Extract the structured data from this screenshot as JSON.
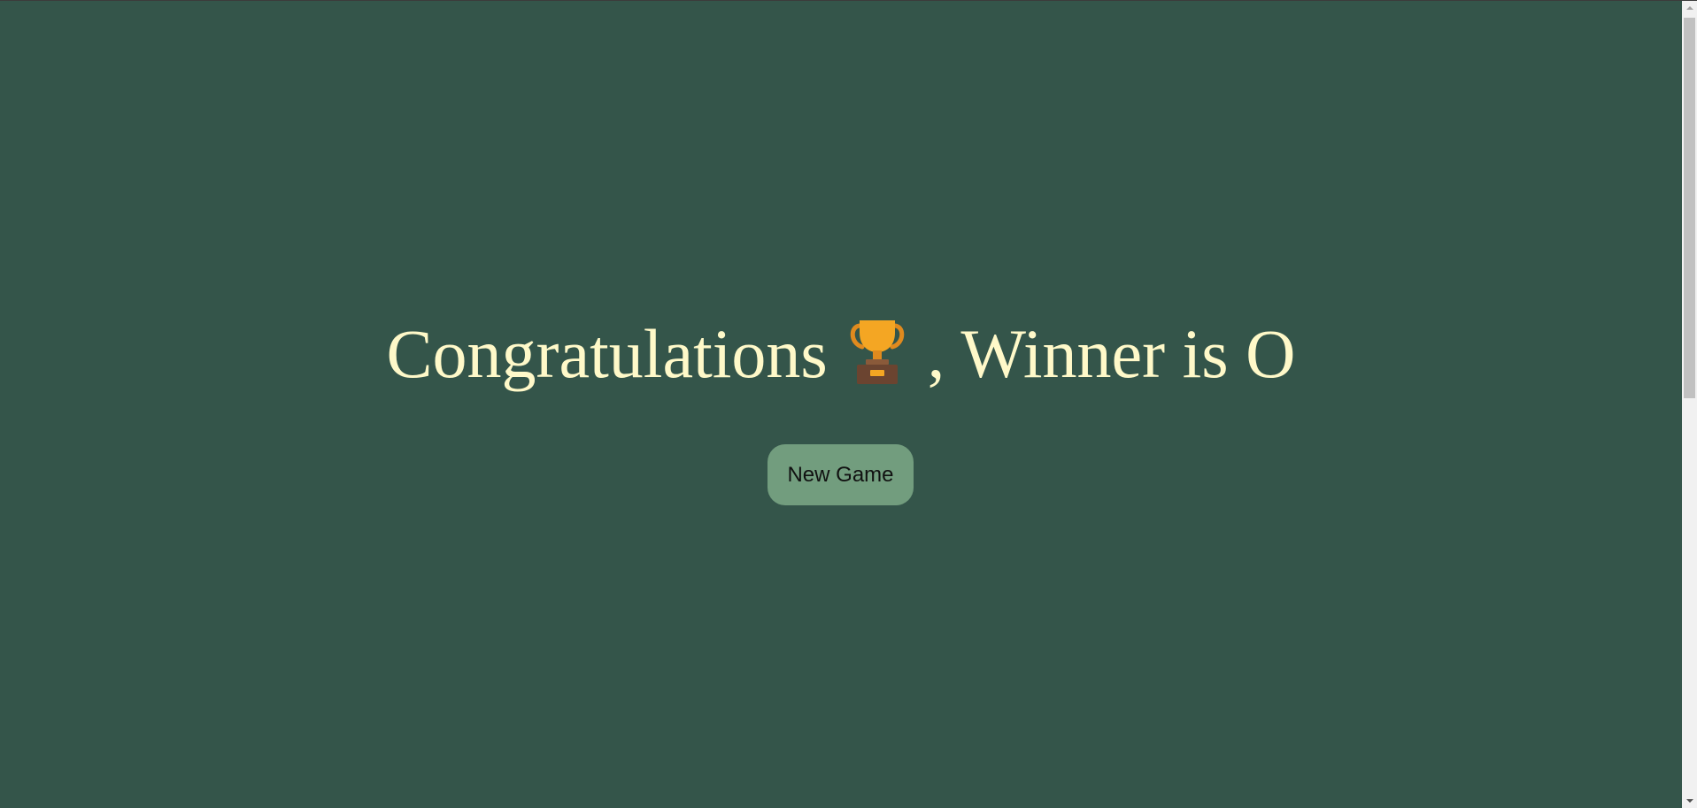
{
  "game": {
    "message_prefix": "Congratulations",
    "trophy_icon": "trophy-icon",
    "message_suffix": ", Winner is O",
    "new_game_label": "New Game"
  },
  "colors": {
    "background": "#34554a",
    "message_text": "#fff9c9",
    "button_background": "#729d7e",
    "button_text": "#111111"
  }
}
